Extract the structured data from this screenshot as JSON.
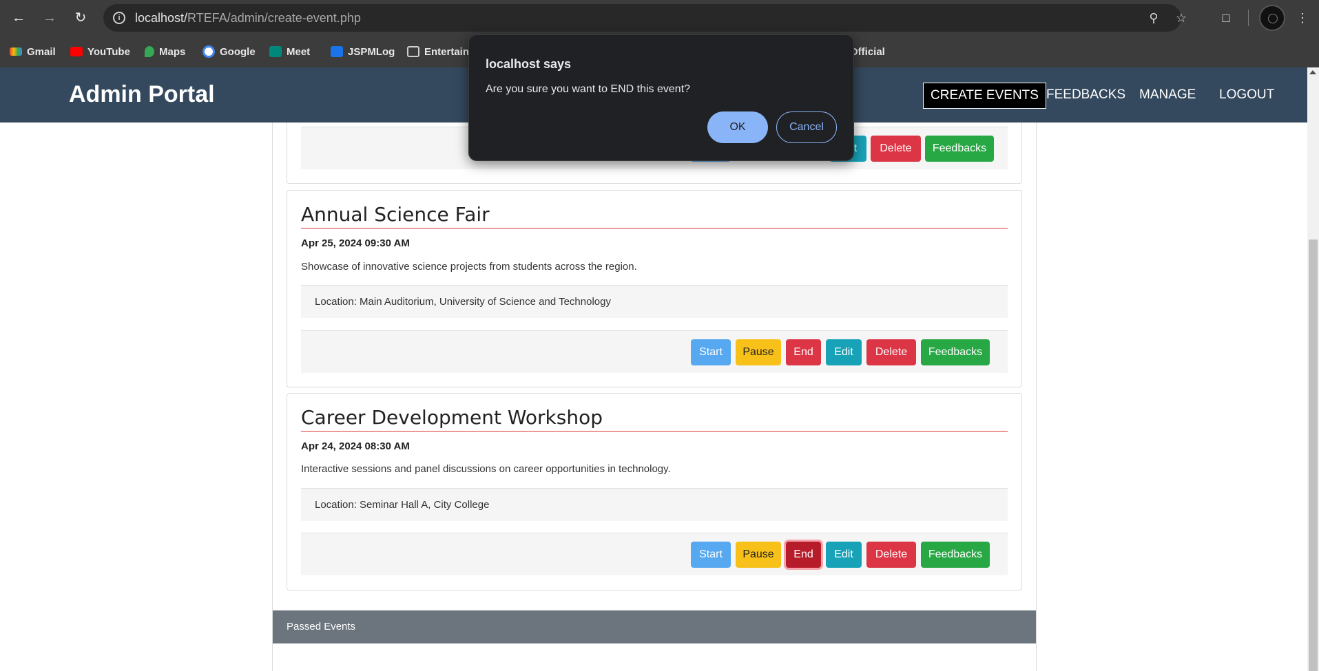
{
  "browser": {
    "url_host": "localhost/",
    "url_path": "RTEFA/admin/create-event.php",
    "bookmarks": [
      "Gmail",
      "YouTube",
      "Maps",
      "Google",
      "Meet",
      "JSPMLog",
      "Entertain",
      "Official"
    ]
  },
  "header": {
    "brand": "Admin Portal",
    "nav": [
      "CREATE EVENTS",
      "FEEDBACKS",
      "MANAGE",
      "LOGOUT"
    ]
  },
  "buttons": {
    "start": "Start",
    "pause": "Pause",
    "end": "End",
    "edit": "Edit",
    "delete": "Delete",
    "feedbacks": "Feedbacks",
    "partial_edit": "t"
  },
  "events": [
    {
      "title": "Annual Science Fair",
      "date": "Apr 25, 2024 09:30 AM",
      "description": "Showcase of innovative science projects from students across the region.",
      "location": "Location: Main Auditorium, University of Science and Technology"
    },
    {
      "title": "Career Development Workshop",
      "date": "Apr 24, 2024 08:30 AM",
      "description": "Interactive sessions and panel discussions on career opportunities in technology.",
      "location": "Location: Seminar Hall A, City College"
    }
  ],
  "passed_events": "Passed Events",
  "dialog": {
    "title": "localhost says",
    "message": "Are you sure you want to END this event?",
    "ok": "OK",
    "cancel": "Cancel"
  },
  "colors": {
    "header_bg": "#34495e",
    "start": "#56a8f0",
    "pause": "#f7c11a",
    "end": "#dc3545",
    "edit": "#17a2b8",
    "feedbacks": "#28a745",
    "passed_bar": "#6c757d"
  }
}
